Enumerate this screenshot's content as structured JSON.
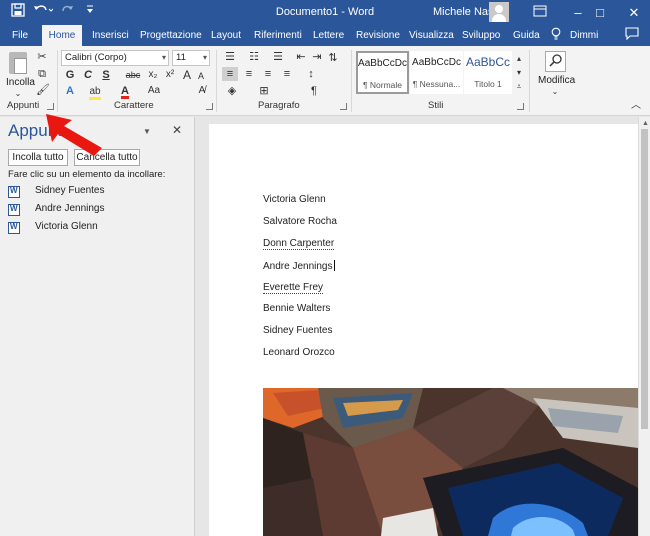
{
  "titlebar": {
    "title": "Documento1 - Word",
    "user": "Michele Nasi",
    "save_icon": "save-icon",
    "undo_icon": "undo-icon",
    "redo_icon": "redo-icon",
    "customize_icon": "customize-qat-icon",
    "minimize": "–",
    "maximize": "□",
    "close": "✕"
  },
  "tabs": [
    {
      "label": "File",
      "active": false
    },
    {
      "label": "Home",
      "active": true
    },
    {
      "label": "Inserisci",
      "active": false
    },
    {
      "label": "Progettazione",
      "active": false
    },
    {
      "label": "Layout",
      "active": false
    },
    {
      "label": "Riferimenti",
      "active": false
    },
    {
      "label": "Lettere",
      "active": false
    },
    {
      "label": "Revisione",
      "active": false
    },
    {
      "label": "Visualizza",
      "active": false
    },
    {
      "label": "Sviluppo",
      "active": false
    },
    {
      "label": "Guida",
      "active": false
    },
    {
      "label": "Dimmi",
      "active": false
    }
  ],
  "ribbon": {
    "groups": {
      "clipboard": "Appunti",
      "font": "Carattere",
      "paragraph": "Paragrafo",
      "styles": "Stili"
    },
    "paste_label": "Incolla",
    "font_name": "Calibri (Corpo)",
    "font_size": "11",
    "bold": "G",
    "italic": "C",
    "underline": "S",
    "strikethrough": "abc",
    "subscript": "x₂",
    "superscript": "x²",
    "grow_font": "A",
    "shrink_font": "A",
    "case": "Aa",
    "font_color": "A",
    "pilcrow": "¶",
    "styles": [
      {
        "sample": "AaBbCcDc",
        "name": "¶ Normale",
        "selected": true
      },
      {
        "sample": "AaBbCcDc",
        "name": "¶ Nessuna...",
        "selected": false
      },
      {
        "sample": "AaBbCc",
        "name": "Titolo 1",
        "selected": false
      }
    ],
    "editing_label": "Modifica"
  },
  "clipboard_pane": {
    "title": "Appunti",
    "paste_all": "Incolla tutto",
    "clear_all": "Cancella tutto",
    "hint": "Fare clic su un elemento da incollare:",
    "items": [
      "Sidney Fuentes",
      "Andre Jennings",
      "Victoria Glenn"
    ]
  },
  "document": {
    "lines": [
      {
        "text": "Victoria Glenn",
        "misspelled": false,
        "caret": false
      },
      {
        "text": "Salvatore Rocha",
        "misspelled": false,
        "caret": false
      },
      {
        "text": "Donn Carpenter",
        "misspelled": true,
        "caret": false
      },
      {
        "text": "Andre Jennings",
        "misspelled": false,
        "caret": true
      },
      {
        "text": "Everette Frey",
        "misspelled": true,
        "caret": false
      },
      {
        "text": "Bennie Walters",
        "misspelled": false,
        "caret": false
      },
      {
        "text": "Sidney Fuentes",
        "misspelled": false,
        "caret": false
      },
      {
        "text": "Leonard Orozco",
        "misspelled": false,
        "caret": false
      }
    ]
  },
  "colors": {
    "brand": "#2b579a",
    "highlight_yellow": "#ffeb3b",
    "font_red": "#e0231b",
    "annotation_red": "#e8170f"
  }
}
